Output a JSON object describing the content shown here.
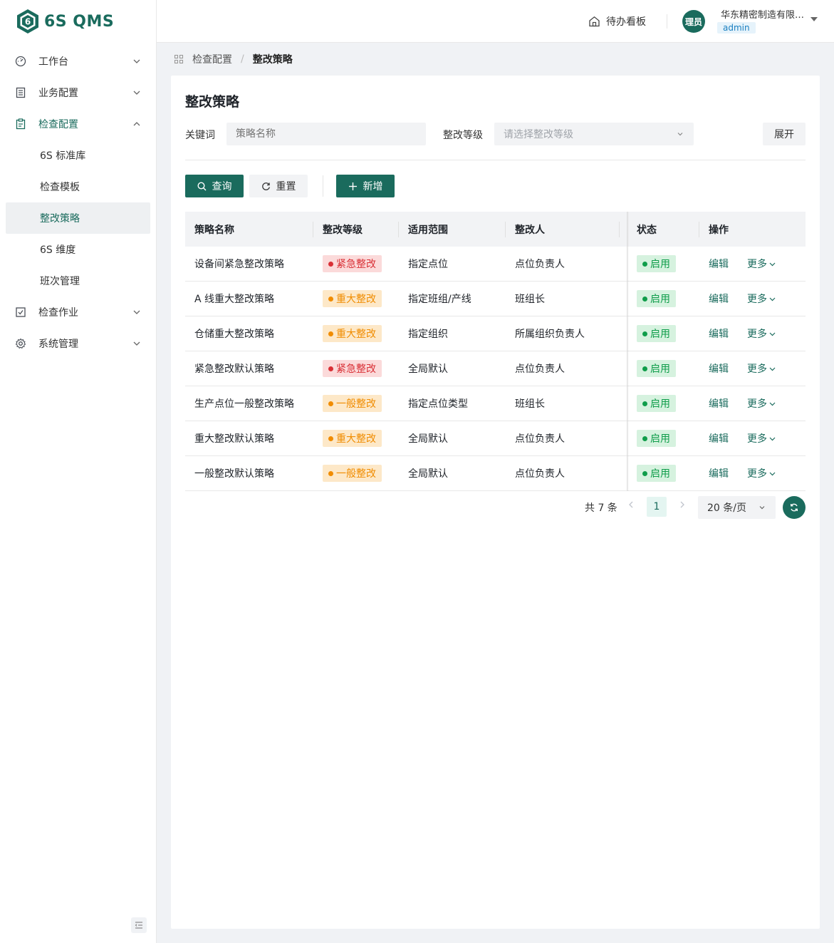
{
  "app": {
    "logo_text": "6S QMS",
    "brand_color": "#1a6b5d"
  },
  "sidebar": {
    "items": [
      {
        "label": "工作台",
        "icon": "dashboard-icon"
      },
      {
        "label": "业务配置",
        "icon": "list-icon"
      },
      {
        "label": "检查配置",
        "icon": "clipboard-icon"
      },
      {
        "label": "检查作业",
        "icon": "checkbox-icon"
      },
      {
        "label": "系统管理",
        "icon": "gear-icon"
      }
    ],
    "sub_items": [
      "6S 标准库",
      "检查模板",
      "整改策略",
      "6S 维度",
      "班次管理"
    ]
  },
  "header": {
    "todo_label": "待办看板",
    "avatar_text": "理员",
    "org_name": "华东精密制造有限公司",
    "role": "admin"
  },
  "breadcrumb": {
    "parent": "检查配置",
    "separator": "/",
    "current": "整改策略"
  },
  "page": {
    "title": "整改策略"
  },
  "filters": {
    "keyword_label": "关键词",
    "keyword_placeholder": "策略名称",
    "level_label": "整改等级",
    "level_placeholder": "请选择整改等级",
    "expand_label": "展开"
  },
  "actions": {
    "query": "查询",
    "reset": "重置",
    "add": "新增"
  },
  "table": {
    "columns": [
      "策略名称",
      "整改等级",
      "适用范围",
      "整改人",
      "状态",
      "操作"
    ],
    "rows": [
      {
        "name": "设备间紧急整改策略",
        "level": "紧急整改",
        "level_type": "red",
        "scope": "指定点位",
        "assignee": "点位负责人",
        "status": "启用"
      },
      {
        "name": "A 线重大整改策略",
        "level": "重大整改",
        "level_type": "orange",
        "scope": "指定班组/产线",
        "assignee": "班组长",
        "status": "启用"
      },
      {
        "name": "仓储重大整改策略",
        "level": "重大整改",
        "level_type": "orange",
        "scope": "指定组织",
        "assignee": "所属组织负责人",
        "status": "启用"
      },
      {
        "name": "紧急整改默认策略",
        "level": "紧急整改",
        "level_type": "red",
        "scope": "全局默认",
        "assignee": "点位负责人",
        "status": "启用"
      },
      {
        "name": "生产点位一般整改策略",
        "level": "一般整改",
        "level_type": "orange",
        "scope": "指定点位类型",
        "assignee": "班组长",
        "status": "启用"
      },
      {
        "name": "重大整改默认策略",
        "level": "重大整改",
        "level_type": "orange",
        "scope": "全局默认",
        "assignee": "点位负责人",
        "status": "启用"
      },
      {
        "name": "一般整改默认策略",
        "level": "一般整改",
        "level_type": "orange",
        "scope": "全局默认",
        "assignee": "点位负责人",
        "status": "启用"
      }
    ],
    "edit_label": "编辑",
    "more_label": "更多"
  },
  "pagination": {
    "total": "共 7 条",
    "current_page": "1",
    "page_size": "20 条/页"
  }
}
